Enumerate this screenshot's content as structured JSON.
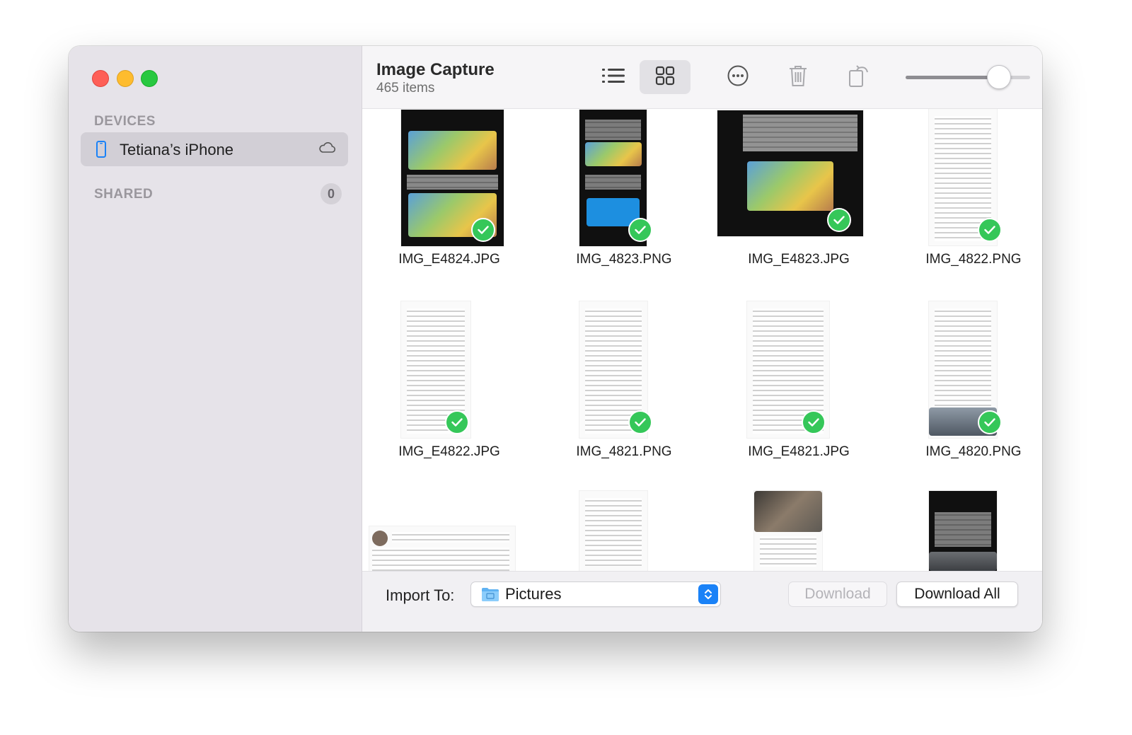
{
  "window": {
    "traffic_lights": [
      "close",
      "minimize",
      "zoom"
    ]
  },
  "sidebar": {
    "devices_header": "DEVICES",
    "device": {
      "label": "Tetiana’s iPhone",
      "icon": "iphone-icon",
      "status_icon": "cloud-icon"
    },
    "shared_header": "SHARED",
    "shared_count": "0"
  },
  "toolbar": {
    "title": "Image Capture",
    "subtitle": "465 items",
    "buttons": [
      "list-view",
      "grid-view",
      "more",
      "delete",
      "rotate"
    ],
    "active_view": "grid-view",
    "thumbnail_size": 0.8
  },
  "grid": {
    "items": [
      {
        "name": "IMG_E4824.JPG",
        "selected": true
      },
      {
        "name": "IMG_4823.PNG",
        "selected": true
      },
      {
        "name": "IMG_E4823.JPG",
        "selected": true
      },
      {
        "name": "IMG_4822.PNG",
        "selected": true
      },
      {
        "name": "IMG_E4822.JPG",
        "selected": true
      },
      {
        "name": "IMG_4821.PNG",
        "selected": true
      },
      {
        "name": "IMG_E4821.JPG",
        "selected": true
      },
      {
        "name": "IMG_4820.PNG",
        "selected": true
      }
    ]
  },
  "bottom": {
    "import_label": "Import To:",
    "destination": "Pictures",
    "download_label": "Download",
    "download_all_label": "Download All"
  },
  "colors": {
    "accent": "#1a82f7",
    "check": "#35c759",
    "sidebar_bg": "#e6e3e9"
  }
}
